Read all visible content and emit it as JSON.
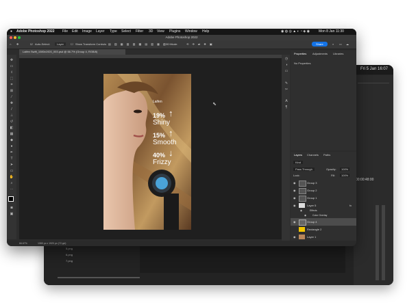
{
  "back_window": {
    "clock": "Fri 5 Jan 16:07",
    "timecode": "00:00:48:00",
    "files": [
      "5.png",
      "6.png",
      "7.png"
    ]
  },
  "menubar": {
    "app_name": "Adobe Photoshop 2022",
    "items": [
      "File",
      "Edit",
      "Image",
      "Layer",
      "Type",
      "Select",
      "Filter",
      "3D",
      "View",
      "Plugins",
      "Window",
      "Help"
    ],
    "clock": "Mon 8 Jan 11:30"
  },
  "title_bar": {
    "title": "Adobe Photoshop 2022"
  },
  "options_bar": {
    "auto_select_label": "Auto-Select:",
    "auto_select_value": "Layer",
    "show_transform_label": "Show Transform Controls",
    "mode_label": "3D Mode:",
    "share_label": "Share"
  },
  "document_tab": {
    "title": "Laifen Swift_1080x1920_003.psd @ 66.7% (Group 4, RGB/8)"
  },
  "artwork": {
    "brand": "Laifen",
    "stats": [
      {
        "value": "19%",
        "label": "Shiny",
        "arrow": "↑"
      },
      {
        "value": "15%",
        "label": "Smooth",
        "arrow": "↑"
      },
      {
        "value": "40%",
        "label": "Frizzy",
        "arrow": "↓"
      }
    ]
  },
  "status_bar": {
    "zoom": "66.67%",
    "doc_info": "1080 px x 1920 px (72 ppi)"
  },
  "panels": {
    "top_tabs": [
      "Properties",
      "Adjustments",
      "Libraries"
    ],
    "properties_empty": "No Properties",
    "layers_tabs": [
      "Layers",
      "Channels",
      "Paths"
    ],
    "filter_label": "Kind",
    "blend_mode": "Pass Through",
    "opacity_label": "Opacity:",
    "opacity_value": "100%",
    "lock_label": "Lock:",
    "fill_label": "Fill:",
    "fill_value": "100%"
  },
  "layers": [
    {
      "name": "Group 3",
      "type": "group"
    },
    {
      "name": "Group 2",
      "type": "group"
    },
    {
      "name": "Group 1",
      "type": "group"
    },
    {
      "name": "Layer 5",
      "type": "layer"
    },
    {
      "name": "Effects",
      "type": "effect"
    },
    {
      "name": "Color Overlay",
      "type": "effect"
    },
    {
      "name": "Group 4",
      "type": "group",
      "selected": true
    },
    {
      "name": "Rectangle 2",
      "type": "shape"
    },
    {
      "name": "Layer 1",
      "type": "layer"
    }
  ],
  "colors": {
    "share_button": "#1473e6",
    "selected_layer": "#4c4c4c",
    "rectangle_thumb": "#f2c500"
  }
}
